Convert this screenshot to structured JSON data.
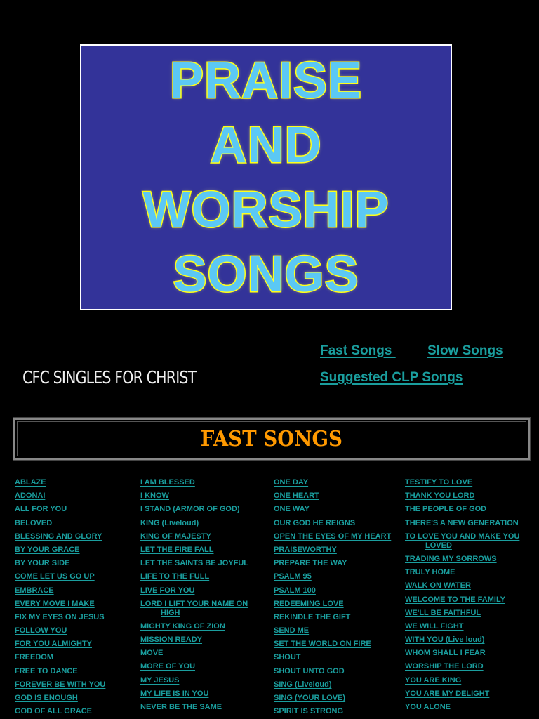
{
  "banner": {
    "lines": [
      "PRAISE",
      "AND",
      "WORSHIP",
      "SONGS"
    ],
    "fill_color": "#5bc8f5",
    "stroke_color": "#ffff00",
    "background": "#333399"
  },
  "logo": {
    "icon": "cfc-cross-dove-icon",
    "text": "CFC SINGLES FOR CHRIST"
  },
  "nav": {
    "fast_songs": "Fast Songs ",
    "slow_songs": "Slow Songs",
    "suggested_clp": "Suggested CLP Songs",
    "link_color": "#1a9e9e"
  },
  "section": {
    "title": "FAST SONGS",
    "title_color": "#ff9900"
  },
  "songs": {
    "col1": [
      "ABLAZE",
      "ADONAI",
      "ALL FOR YOU",
      "BELOVED",
      "BLESSING AND GLORY",
      "BY YOUR GRACE",
      "BY YOUR SIDE",
      "COME LET US GO UP",
      "EMBRACE",
      "EVERY MOVE I MAKE",
      "FIX MY EYES ON JESUS",
      "FOLLOW YOU",
      "FOR YOU ALMIGHTY",
      "FREEDOM",
      "FREE TO DANCE",
      "FOREVER BE WITH YOU",
      "GOD IS ENOUGH",
      "GOD OF ALL GRACE"
    ],
    "col2": [
      "I AM BLESSED",
      "I  KNOW",
      "I STAND (ARMOR OF GOD)",
      "KING (Liveloud)",
      "KING OF MAJESTY",
      "LET THE FIRE FALL",
      "LET THE SAINTS BE JOYFUL",
      "LIFE TO THE FULL",
      "LIVE FOR YOU",
      [
        "LORD I LIFT YOUR NAME ON",
        "HIGH"
      ],
      "MIGHTY KING OF ZION",
      "MISSION READY",
      "MOVE",
      "MORE OF YOU",
      "MY JESUS",
      "MY LIFE IS IN YOU",
      "NEVER BE THE SAME"
    ],
    "col3": [
      "ONE DAY",
      "ONE HEART",
      "ONE WAY",
      "OUR GOD HE REIGNS",
      "OPEN THE EYES OF MY HEART",
      "PRAISEWORTHY",
      "PREPARE THE WAY",
      "PSALM 95",
      "PSALM 100",
      "REDEEMING LOVE",
      "REKINDLE THE GIFT",
      "SEND ME",
      "SET THE WORLD ON FIRE",
      "SHOUT",
      "SHOUT UNTO GOD",
      "SING (Liveloud)",
      "SING (YOUR LOVE)",
      "SPIRIT IS STRONG"
    ],
    "col4": [
      "TESTIFY TO LOVE",
      "THANK YOU LORD",
      "THE PEOPLE OF GOD",
      "THERE'S A NEW GENERATION",
      [
        "TO LOVE YOU AND MAKE YOU",
        "LOVED"
      ],
      "TRADING MY SORROWS",
      "TRULY HOME",
      "WALK ON WATER",
      "WELCOME TO THE FAMILY",
      "WE'LL BE FAITHFUL",
      "WE WILL FIGHT",
      "WITH YOU (Live loud)",
      "WHOM SHALL I FEAR",
      "WORSHIP THE LORD",
      "YOU ARE KING",
      "YOU ARE MY DELIGHT",
      "YOU ALONE"
    ]
  }
}
